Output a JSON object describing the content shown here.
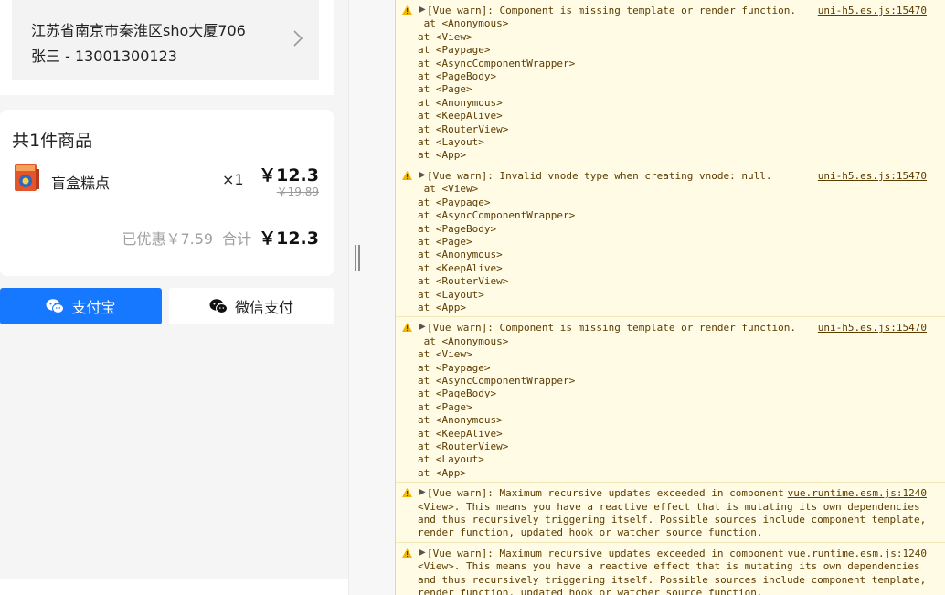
{
  "address": {
    "line": "江苏省南京市秦淮区sho大厦706",
    "contact": "张三 - 13001300123"
  },
  "order": {
    "count_label": "共1件商品",
    "product_name": "盲盒糕点",
    "quantity": "×1",
    "price": "￥12.3",
    "original_price": "￥19.89",
    "discount_text": "已优惠￥7.59",
    "total_label": "合计",
    "total": "￥12.3"
  },
  "payment": {
    "alipay_label": "支付宝",
    "wechat_label": "微信支付"
  },
  "console": {
    "entries": [
      {
        "message": "[Vue warn]: Component is missing template or render function.",
        "source": "uni-h5.es.js:15470",
        "first": " at <Anonymous>",
        "stack": [
          "at <View>",
          "at <Paypage>",
          "at <AsyncComponentWrapper>",
          "at <PageBody>",
          "at <Page>",
          "at <Anonymous>",
          "at <KeepAlive>",
          "at <RouterView>",
          "at <Layout>",
          "at <App>"
        ]
      },
      {
        "message": "[Vue warn]: Invalid vnode type when creating vnode: null.",
        "source": "uni-h5.es.js:15470",
        "first": " at <View>",
        "stack": [
          "at <Paypage>",
          "at <AsyncComponentWrapper>",
          "at <PageBody>",
          "at <Page>",
          "at <Anonymous>",
          "at <KeepAlive>",
          "at <RouterView>",
          "at <Layout>",
          "at <App>"
        ]
      },
      {
        "message": "[Vue warn]: Component is missing template or render function.",
        "source": "uni-h5.es.js:15470",
        "first": " at <Anonymous>",
        "stack": [
          "at <View>",
          "at <Paypage>",
          "at <AsyncComponentWrapper>",
          "at <PageBody>",
          "at <Page>",
          "at <Anonymous>",
          "at <KeepAlive>",
          "at <RouterView>",
          "at <Layout>",
          "at <App>"
        ]
      },
      {
        "message": "[Vue warn]: Maximum recursive updates exceeded in component",
        "source": "vue.runtime.esm.js:1240",
        "continuation": "<View>. This means you have a reactive effect that is mutating its own dependencies and thus recursively triggering itself. Possible sources include component template, render function, updated hook or watcher source function."
      },
      {
        "message": "[Vue warn]: Maximum recursive updates exceeded in component",
        "source": "vue.runtime.esm.js:1240",
        "continuation": "<View>. This means you have a reactive effect that is mutating its own dependencies and thus recursively triggering itself. Possible sources include component template, render function, updated hook or watcher source function."
      }
    ]
  },
  "colors": {
    "alipay_blue": "#1677ff",
    "console_warning_bg": "#fffbe5",
    "warning_icon": "#f2b600"
  }
}
